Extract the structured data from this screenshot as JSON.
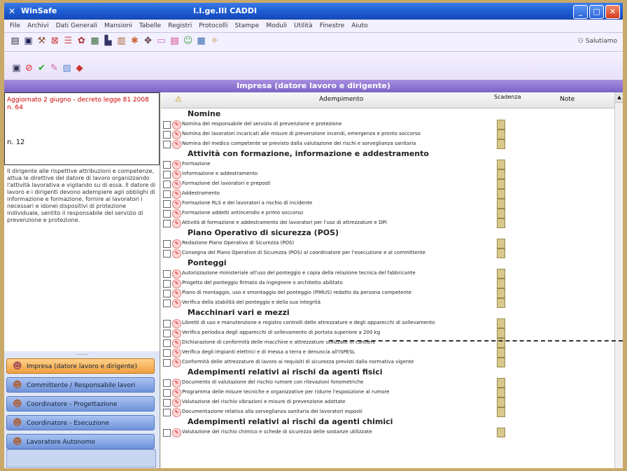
{
  "window": {
    "app_title": "WinSafe",
    "doc_title": "I.I.ge.III CADDI"
  },
  "menu": [
    "File",
    "Archivi",
    "Dati Generali",
    "Mansioni",
    "Tabelle",
    "Registri",
    "Protocolli",
    "Stampe",
    "Moduli",
    "Utilità",
    "Finestre",
    "Aiuto"
  ],
  "toolbar": {
    "user": "Salutiamo"
  },
  "section": {
    "title": "Impresa (datore lavoro e dirigente)"
  },
  "left": {
    "note_red": "Aggiornato 2 giugno - decreto legge 81 2008 n. 64",
    "note_small": "n. 12",
    "description": "Il dirigente alle rispettive attribuzioni e competenze, attua le direttive del datore di lavoro organizzando l'attività lavorativa e vigilando su di essa. Il datore di lavoro e i dirigenti devono adempiere agli obblighi di informazione e formazione, fornire ai lavoratori i necessari e idonei dispositivi di protezione individuale, sentito il responsabile del servizio di prevenzione e protezione."
  },
  "nav": {
    "items": [
      {
        "label": "Impresa (datore lavoro e dirigente)",
        "active": true
      },
      {
        "label": "Committente / Responsabile lavori",
        "active": false
      },
      {
        "label": "Coordinatore - Progettazione",
        "active": false
      },
      {
        "label": "Coordinatore - Esecuzione",
        "active": false
      },
      {
        "label": "Lavoratore Autonomo",
        "active": false
      }
    ]
  },
  "columns": {
    "adempimento": "Adempimento",
    "scadenza": "Scadenza",
    "note": "Note"
  },
  "groups": [
    {
      "title": "Nomine",
      "items": [
        "Nomina del responsabile del servizio di prevenzione e protezione",
        "Nomina dei lavoratori incaricati alle misure di prevenzione incendi, emergenza e pronto soccorso",
        "Nomina del medico competente se previsto dalla valutazione dei rischi e sorveglianza sanitaria"
      ]
    },
    {
      "title": "Attività con formazione, informazione e addestramento",
      "items": [
        "Formazione",
        "Informazione e addestramento",
        "Formazione dei lavoratori e preposti",
        "Addestramento",
        "Formazione RLS e dei lavoratori a rischio di incidente",
        "Formazione addetti antincendio e primo soccorso",
        "Attività di formazione e addestramento dei lavoratori per l'uso di attrezzature e DPI"
      ]
    },
    {
      "title": "Piano Operativo di sicurezza (POS)",
      "items": [
        "Redazione Piano Operativo di Sicurezza (POS)",
        "Consegna del Piano Operativo di Sicurezza (POS) al coordinatore per l'esecuzione e al committente"
      ]
    },
    {
      "title": "Ponteggi",
      "items": [
        "Autorizzazione ministeriale all'uso del ponteggio e copia della relazione tecnica del fabbricante",
        "Progetto del ponteggio firmato da ingegnere o architetto abilitato",
        "Piano di montaggio, uso e smontaggio del ponteggio (PiMUS) redatto da persona competente",
        "Verifica della stabilità del ponteggio e della sua integrità"
      ]
    },
    {
      "title": "Macchinari vari e mezzi",
      "items": [
        "Libretti di uso e manutenzione e registro controlli delle attrezzature e degli apparecchi di sollevamento",
        "Verifica periodica degli apparecchi di sollevamento di portata superiore a 200 kg",
        "Dichiarazione di conformità delle macchine e attrezzature utilizzate in cantiere",
        "Verifica degli impianti elettrici e di messa a terra e denuncia all'ISPESL",
        "Conformità delle attrezzature di lavoro ai requisiti di sicurezza previsti dalla normativa vigente"
      ]
    },
    {
      "title": "Adempimenti relativi ai rischi da agenti fisici",
      "items": [
        "Documento di valutazione del rischio rumore con rilevazioni fonometriche",
        "Programma delle misure tecniche e organizzative per ridurre l'esposizione al rumore",
        "Valutazione del rischio vibrazioni e misure di prevenzione adottate",
        "Documentazione relativa alla sorveglianza sanitaria dei lavoratori esposti"
      ]
    },
    {
      "title": "Adempimenti relativi ai rischi da agenti chimici",
      "items": [
        "Valutazione del rischio chimico e schede di sicurezza delle sostanze utilizzate"
      ]
    }
  ]
}
